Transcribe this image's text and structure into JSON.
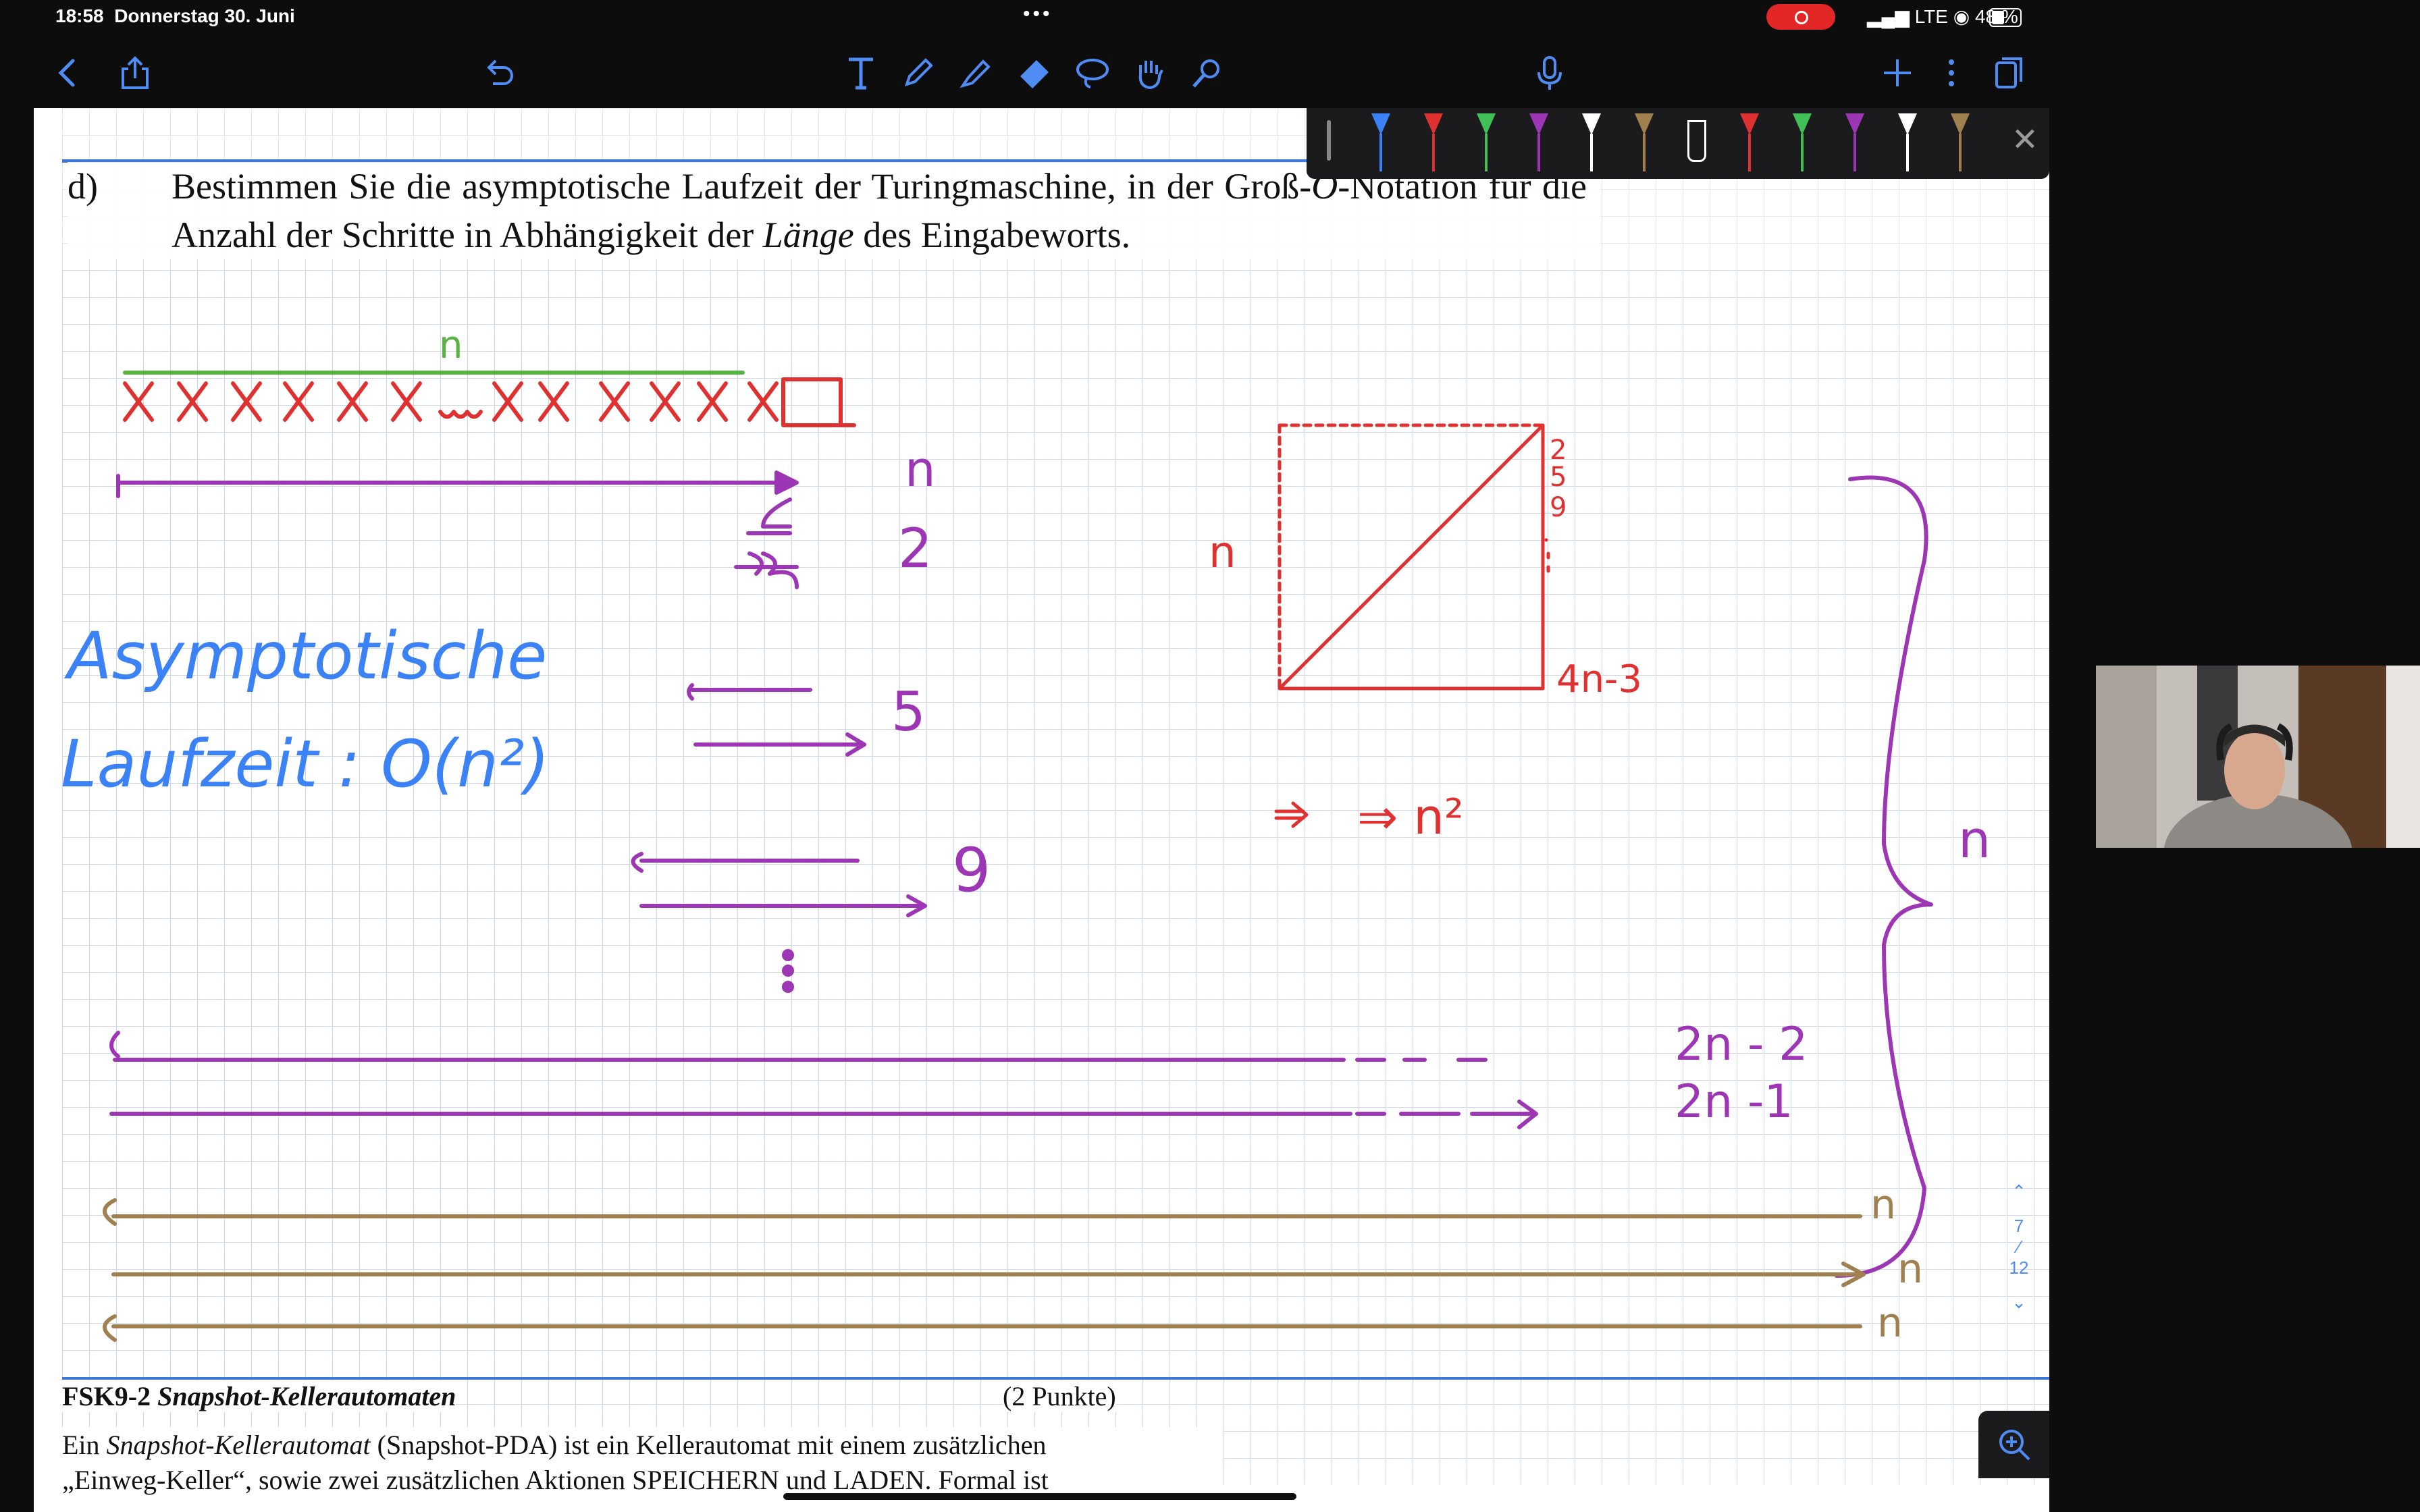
{
  "status_bar": {
    "time": "18:58",
    "date": "Donnerstag 30. Juni",
    "network": "LTE",
    "battery": "48 %"
  },
  "toolbar": {
    "back_icon": "chevron-left-icon",
    "share_icon": "share-icon",
    "undo_icon": "undo-icon",
    "tools": [
      "text-tool-icon",
      "pen-icon",
      "highlighter-icon",
      "eraser-icon",
      "lasso-icon",
      "hand-icon",
      "laser-pointer-icon"
    ],
    "mic_icon": "microphone-icon",
    "add_icon": "plus-icon",
    "more_icon": "more-icon",
    "pages_icon": "pages-icon",
    "accent_color": "#4f8df5"
  },
  "pen_palette": {
    "colors": [
      "#3b82f6",
      "#e03131",
      "#40c057",
      "#9c36b5",
      "#ffffff",
      "#a0804f",
      "#ffffff",
      "#e03131",
      "#40c057",
      "#9c36b5",
      "#ffffff",
      "#a0804f"
    ],
    "close_label": "✕"
  },
  "task": {
    "label": "d)",
    "text_before": "Bestimmen Sie die asymptotische Laufzeit der Turingmaschine, in der Groß-",
    "o": "O",
    "text_mid": "-Notation für die Anzahl der Schritte in Abhängigkeit der ",
    "emphasis": "Länge",
    "text_after": " des Eingabeworts."
  },
  "handwriting": {
    "n_top": "n",
    "n_right_1": "n",
    "two": "2",
    "five": "5",
    "nine": "9",
    "asym_1": "Asymptotische",
    "asym_2": "Laufzeit :  O(n²)",
    "triangle_n": "n",
    "triangle_side": "2",
    "triangle_side_2": "5",
    "triangle_side_3": "9",
    "triangle_bottom": "4n-3",
    "implies": "⇒ n²",
    "brace_n": "n",
    "two_n_minus_2": "2n - 2",
    "two_n_minus_1": "2n -1",
    "brown_n_1": "n",
    "brown_n_2": "n",
    "brown_n_3": "n"
  },
  "section": {
    "number": "FSK9-2",
    "title": "Snapshot-Kellerautomaten",
    "points": "(2 Punkte)",
    "text_1_pre": "Ein ",
    "text_1_em": "Snapshot-Kellerautomat",
    "text_1_post": " (Snapshot-PDA) ist ein Kellerautomat mit einem zusätzlichen",
    "text_2": "„Einweg-Keller“, sowie zwei zusätzlichen Aktionen SPEICHERN und LADEN. Formal ist"
  },
  "pager": {
    "current": "7",
    "total": "12"
  }
}
